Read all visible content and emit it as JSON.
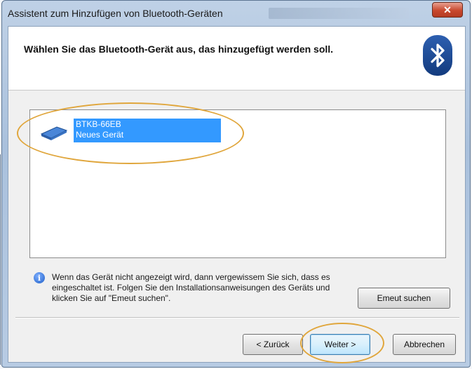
{
  "window": {
    "title": "Assistent zum Hinzufügen von Bluetooth-Geräten",
    "close_label": "✕"
  },
  "header": {
    "title": "Wählen Sie das Bluetooth-Gerät aus, das hinzugefügt werden soll.",
    "icon": "bluetooth-icon"
  },
  "devices": [
    {
      "name": "BTKB-66EB",
      "type": "Neues Gerät",
      "icon": "keyboard-icon",
      "selected": true
    }
  ],
  "info": {
    "icon": "info-icon",
    "text": "Wenn das Gerät nicht angezeigt wird, dann vergewissem Sie sich, dass es eingeschaltet ist. Folgen Sie den Installationsanweisungen des Geräts und klicken Sie auf \"Emeut suchen\"."
  },
  "buttons": {
    "search_again": "Emeut suchen",
    "back": "< Zurück",
    "next": "Weiter >",
    "cancel": "Abbrechen"
  },
  "colors": {
    "selection": "#3399ff",
    "highlight_circle": "#e0a63c",
    "close_button": "#c8482e"
  }
}
